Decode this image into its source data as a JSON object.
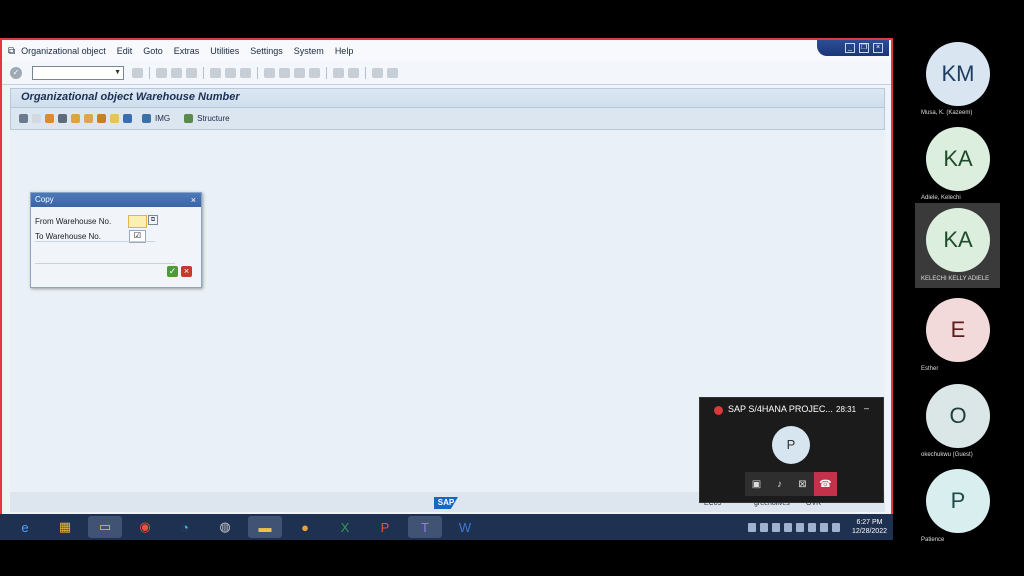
{
  "menubar": {
    "items": [
      "Organizational object",
      "Edit",
      "Goto",
      "Extras",
      "Utilities",
      "Settings",
      "System",
      "Help"
    ]
  },
  "header": {
    "title": "Organizational object Warehouse Number"
  },
  "app_toolbar": {
    "img_label": "IMG",
    "structure_label": "Structure"
  },
  "dialog": {
    "title": "Copy",
    "from_label": "From Warehouse No.",
    "to_label": "To Warehouse No.",
    "to_value": "☑"
  },
  "statusbar": {
    "sap_logo": "SAP",
    "system": "EC09",
    "host": "greenolives",
    "mode": "OVR"
  },
  "taskbar": {
    "time": "6:27 PM",
    "date": "12/28/2022"
  },
  "meeting": {
    "title": "SAP S/4HANA PROJEC...",
    "elapsed": "28:31",
    "avatar_letter": "P"
  },
  "participants": [
    {
      "initials": "KM",
      "name": "Musa, K. (Kazeem)",
      "bg": "#d9e6f2",
      "fg": "#1d3d63"
    },
    {
      "initials": "KA",
      "name": "Adiele, Kelechi",
      "bg": "#dceede",
      "fg": "#1e4d2b"
    },
    {
      "initials": "KA",
      "name": "KELECHI KELLY ADIELE",
      "bg": "#dceede",
      "fg": "#1e4d2b"
    },
    {
      "initials": "E",
      "name": "Esther",
      "bg": "#f3dada",
      "fg": "#5c1f1f"
    },
    {
      "initials": "O",
      "name": "okechukwu (Guest)",
      "bg": "#dbe6e6",
      "fg": "#1f3f3f"
    },
    {
      "initials": "P",
      "name": "Patience",
      "bg": "#d9eeee",
      "fg": "#1f4a4a"
    }
  ]
}
